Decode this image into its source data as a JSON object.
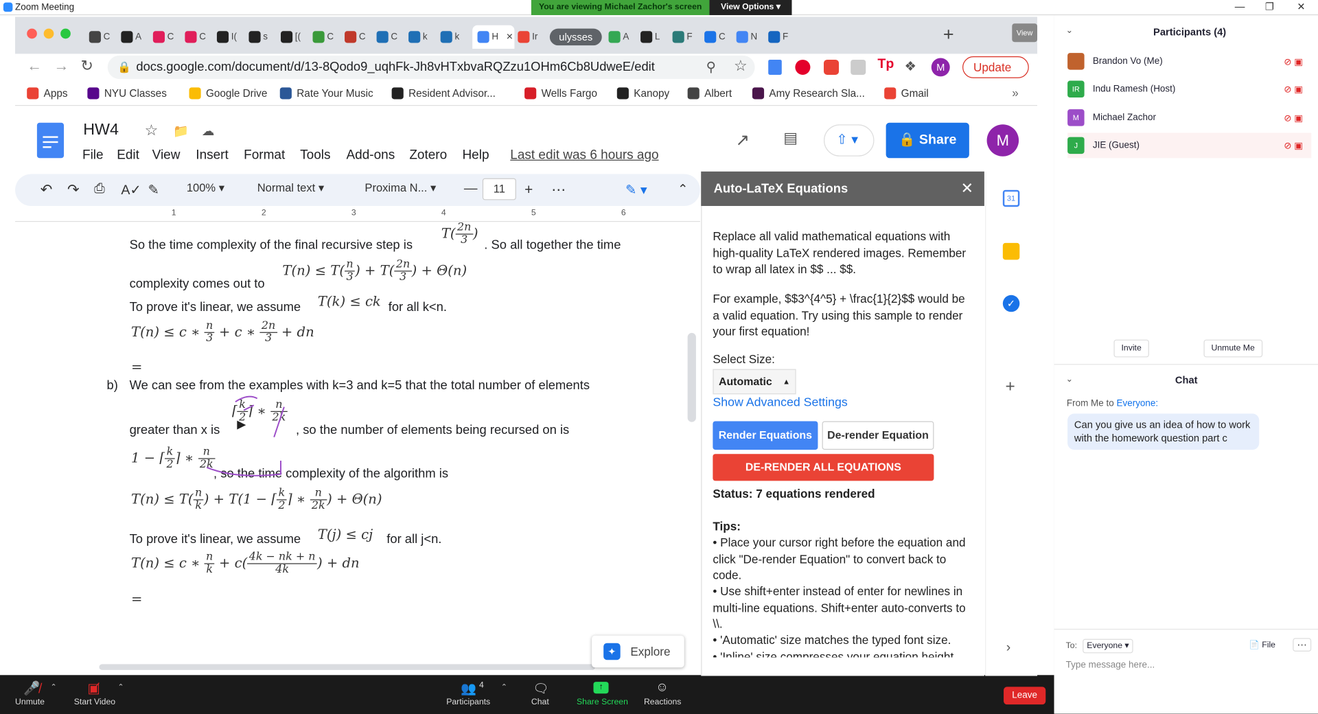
{
  "zoom": {
    "window_title": "Zoom Meeting",
    "banner_text": "You are viewing Michael Zachor's screen",
    "view_options_label": "View Options",
    "view_label": "View"
  },
  "browser": {
    "url": "docs.google.com/document/d/13-8Qodo9_uqhFk-Jh8vHTxbvaRQZzu1OHm6Cb8UdweE/edit",
    "active_tab": "H",
    "tabs": [
      {
        "label": "C",
        "icon": "chrome-icon"
      },
      {
        "label": "A",
        "icon": "github-icon"
      },
      {
        "label": "C",
        "icon": "slack-icon"
      },
      {
        "label": "C",
        "icon": "slack-icon"
      },
      {
        "label": "I(",
        "icon": "github-icon"
      },
      {
        "label": "s",
        "icon": "github-icon"
      },
      {
        "label": "[(",
        "icon": "t-icon"
      },
      {
        "label": "C",
        "icon": "infinity-icon"
      },
      {
        "label": "C",
        "icon": "bookmark-icon"
      },
      {
        "label": "C",
        "icon": "p-icon"
      },
      {
        "label": "k",
        "icon": "p-icon"
      },
      {
        "label": "k",
        "icon": "p-icon"
      },
      {
        "label": "H",
        "icon": "docs-icon"
      },
      {
        "label": "Ir",
        "icon": "gmail-icon"
      },
      {
        "label": "ulysses",
        "icon": "group-icon"
      },
      {
        "label": "A",
        "icon": "drive-icon"
      },
      {
        "label": "L",
        "icon": "github-icon"
      },
      {
        "label": "F",
        "icon": "globe-icon"
      },
      {
        "label": "C",
        "icon": "chart-icon"
      },
      {
        "label": "N",
        "icon": "calendar-icon"
      },
      {
        "label": "F",
        "icon": "cloud-icon"
      }
    ],
    "update_label": "Update",
    "profile_initial": "M",
    "bookmarks": [
      {
        "label": "Apps",
        "icon": "apps-icon"
      },
      {
        "label": "NYU Classes",
        "icon": "nyu-icon"
      },
      {
        "label": "Google Drive",
        "icon": "drive-icon"
      },
      {
        "label": "Rate Your Music",
        "icon": "music-icon"
      },
      {
        "label": "Resident Advisor...",
        "icon": "ra-icon"
      },
      {
        "label": "Wells Fargo",
        "icon": "bank-icon"
      },
      {
        "label": "Kanopy",
        "icon": "k-icon"
      },
      {
        "label": "Albert",
        "icon": "globe-icon"
      },
      {
        "label": "Amy Research Sla...",
        "icon": "slack-icon"
      },
      {
        "label": "Gmail",
        "icon": "gmail-icon"
      }
    ]
  },
  "docs": {
    "title": "HW4",
    "menu": [
      "File",
      "Edit",
      "View",
      "Insert",
      "Format",
      "Tools",
      "Add-ons",
      "Zotero",
      "Help"
    ],
    "last_edit": "Last edit was 6 hours ago",
    "share_label": "Share",
    "avatar_initial": "M",
    "toolbar": {
      "zoom": "100%",
      "style": "Normal text",
      "font": "Proxima N...",
      "size": "11"
    },
    "ruler_marks": [
      "1",
      "2",
      "3",
      "4",
      "5",
      "6"
    ],
    "body": {
      "line1": "So the time complexity of the final recursive step is",
      "line1b": ". So all together the time",
      "line2": "complexity comes out to",
      "line3": "To prove it's linear, we assume",
      "line3b": "for all k<n.",
      "equals1": "=",
      "part_b_label": "b)",
      "line4": "We can see from the examples with k=3 and k=5 that the total number of elements",
      "line5": "greater than x is",
      "line5b": ", so the number of elements being recursed on is",
      "line6b": ", so the time complexity of the algorithm is",
      "line7": "To prove it's linear, we assume",
      "line7b": "for all j<n.",
      "equals2": "="
    },
    "explore_label": "Explore"
  },
  "addon": {
    "title": "Auto-LaTeX Equations",
    "intro": "Replace all valid mathematical equations with high-quality LaTeX rendered images. Remember to wrap all latex in $$ ... $$.",
    "example": "For example, $$3^{4^5} + \\frac{1}{2}$$ would be a valid equation. Try using this sample to render your first equation!",
    "select_size_label": "Select Size:",
    "select_size_value": "Automatic",
    "advanced_link": "Show Advanced Settings",
    "render_button": "Render Equations",
    "derender_button": "De-render Equation",
    "derender_all_button": "DE-RENDER ALL EQUATIONS",
    "status": "Status: 7 equations rendered",
    "tips_label": "Tips:",
    "tip1": "• Place your cursor right before the equation and click \"De-render Equation\" to convert back to code.",
    "tip2": "• Use shift+enter instead of enter for newlines in multi-line equations. Shift+enter auto-converts to \\\\.",
    "tip3": "• 'Automatic' size matches the typed font size.",
    "tip4": "• 'Inline' size compresses your equation height"
  },
  "participants": {
    "header": "Participants (4)",
    "list": [
      {
        "name": "Brandon Vo (Me)",
        "initials": "",
        "color": "#c0622d"
      },
      {
        "name": "Indu Ramesh (Host)",
        "initials": "IR",
        "color": "#2eab4b"
      },
      {
        "name": "Michael Zachor",
        "initials": "M",
        "color": "#9c4dc8"
      },
      {
        "name": "JIE (Guest)",
        "initials": "J",
        "color": "#2eab4b"
      }
    ],
    "invite_label": "Invite",
    "unmute_me_label": "Unmute Me"
  },
  "chat": {
    "header": "Chat",
    "from_label": "From Me to ",
    "to_whom": "Everyone:",
    "message": "Can you give us an idea of how to work with the homework question part c",
    "to_label": "To:",
    "recipient": "Everyone",
    "file_label": "File",
    "placeholder": "Type message here..."
  },
  "zoom_toolbar": {
    "unmute": "Unmute",
    "start_video": "Start Video",
    "participants": "Participants",
    "participants_count": "4",
    "chat": "Chat",
    "share_screen": "Share Screen",
    "reactions": "Reactions",
    "leave": "Leave"
  }
}
